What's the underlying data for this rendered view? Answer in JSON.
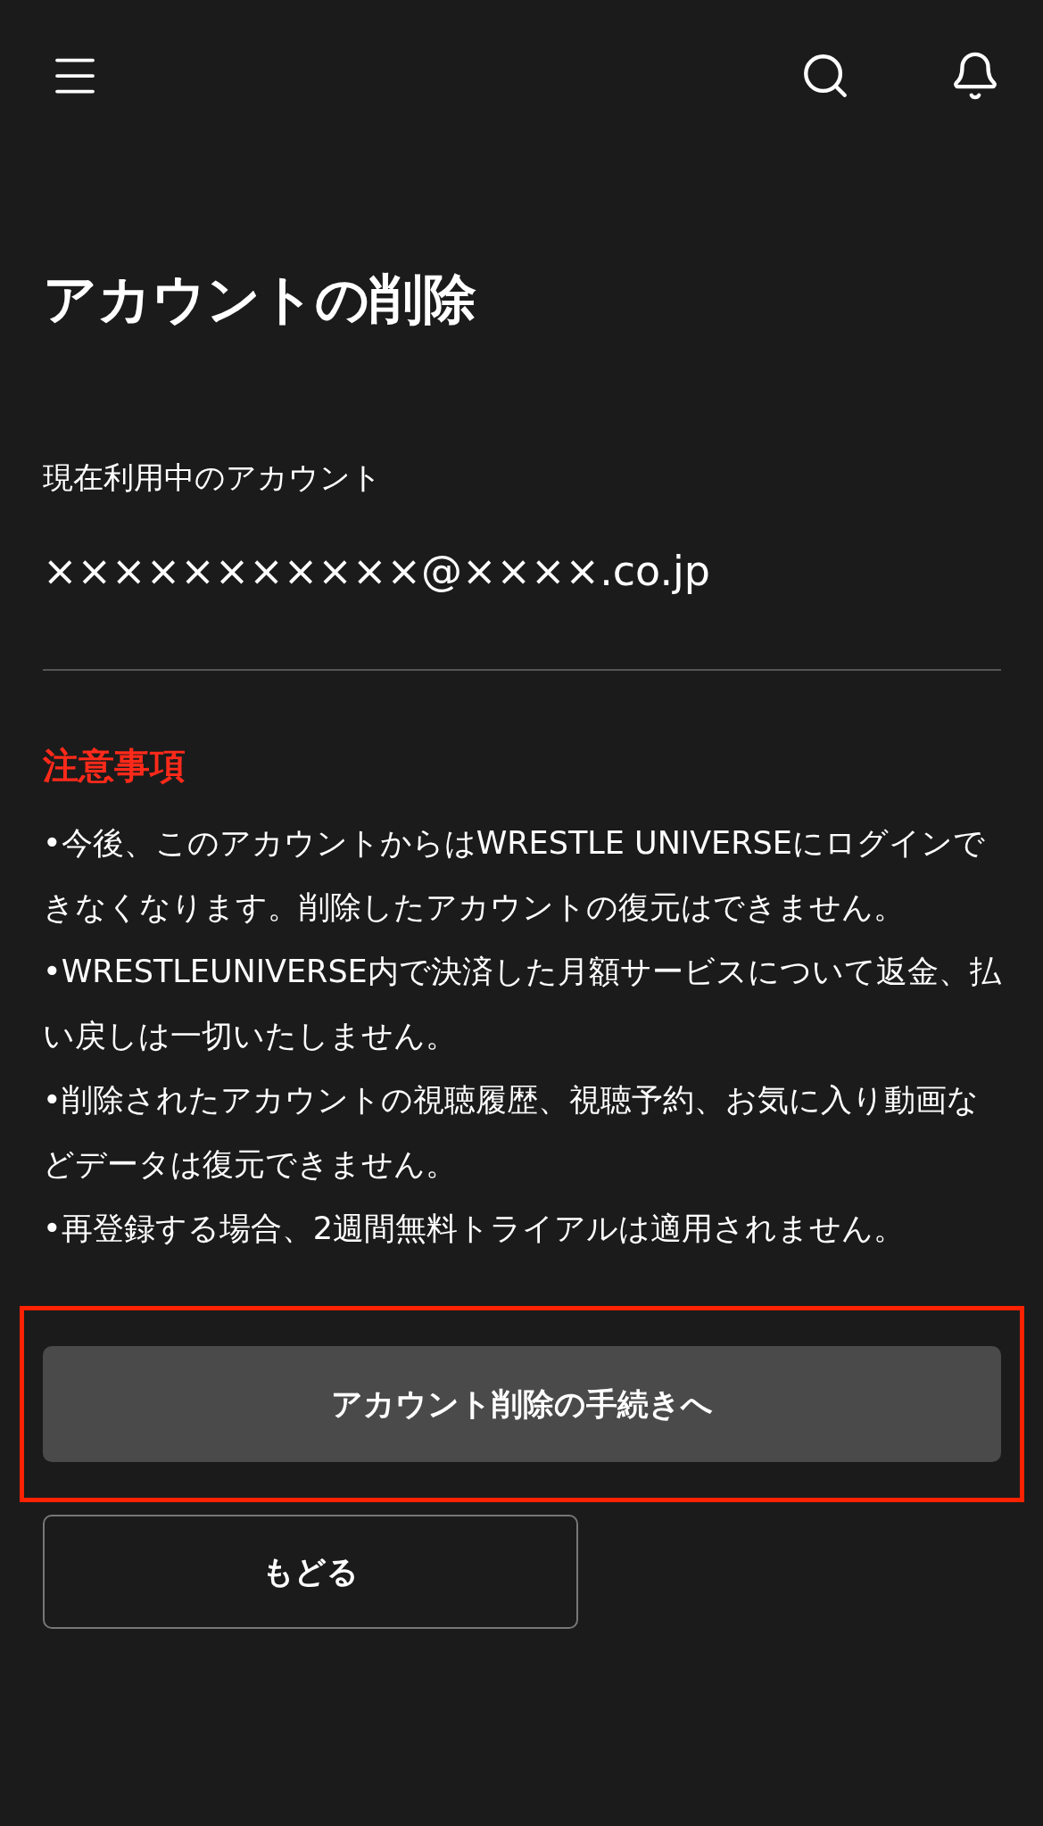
{
  "page_title": "アカウントの削除",
  "account": {
    "label": "現在利用中のアカウント",
    "email": "×××××××××××@××××.co.jp"
  },
  "notice": {
    "heading": "注意事項",
    "items": [
      "•今後、このアカウントからはWRESTLE UNIVERSEにログインできなくなります。削除したアカウントの復元はできません。",
      "•WRESTLEUNIVERSE内で決済した月額サービスについて返金、払い戻しは一切いたしません。",
      "•削除されたアカウントの視聴履歴、視聴予約、お気に入り動画などデータは復元できません。",
      "•再登録する場合、2週間無料トライアルは適用されません。"
    ]
  },
  "buttons": [
    {
      "label": "アカウント削除の手続きへ",
      "kind": "primary",
      "highlighted": true
    },
    {
      "label": "もどる",
      "kind": "outline",
      "highlighted": false
    }
  ]
}
